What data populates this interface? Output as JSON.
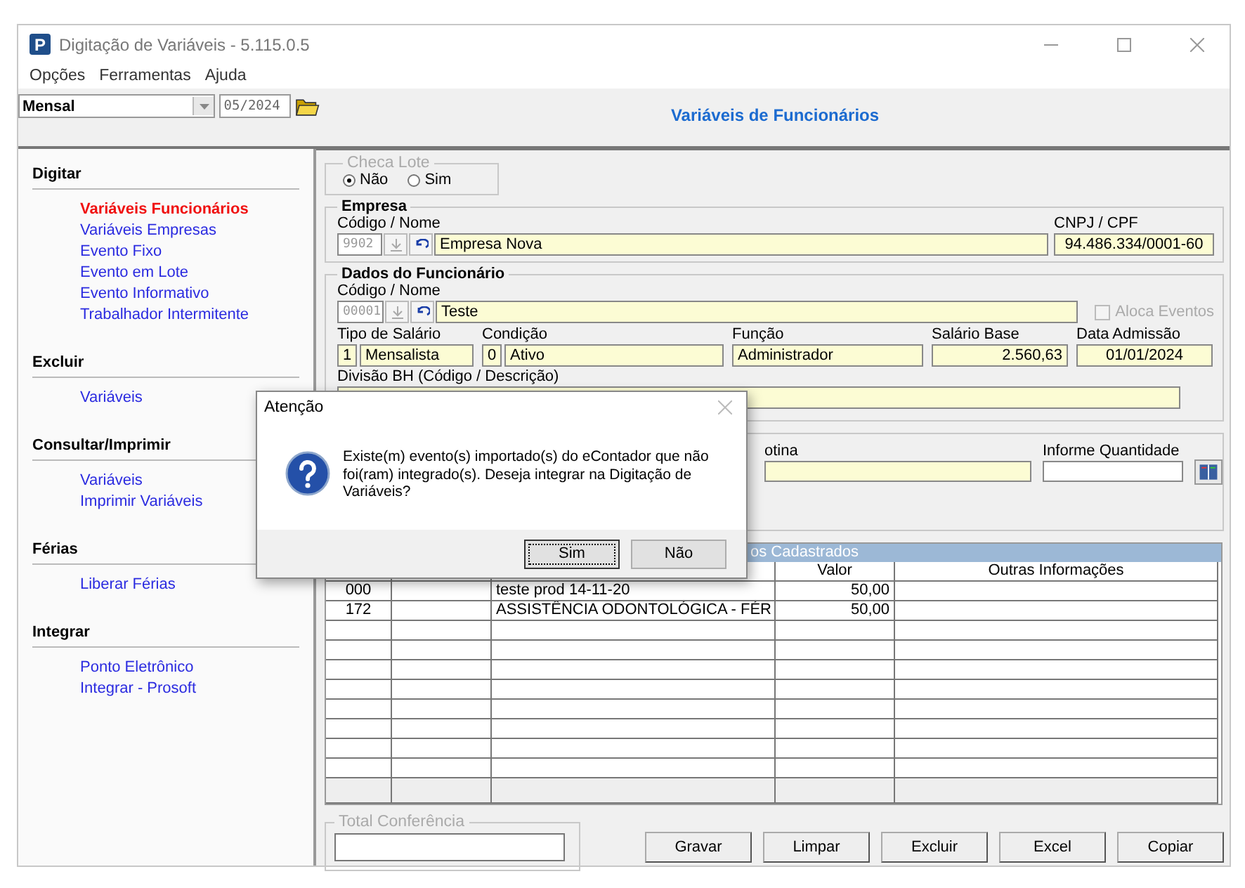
{
  "window": {
    "app_icon": "P",
    "title": "Digitação de Variáveis - 5.115.0.5"
  },
  "menu": [
    "Opções",
    "Ferramentas",
    "Ajuda"
  ],
  "toolbar": {
    "period_type": "Mensal",
    "competence": "05/2024",
    "heading": "Variáveis de Funcionários"
  },
  "sidebar": {
    "sections": [
      {
        "title": "Digitar",
        "items": [
          {
            "label": "Variáveis Funcionários",
            "selected": true
          },
          {
            "label": "Variáveis Empresas",
            "selected": false
          },
          {
            "label": "Evento Fixo",
            "selected": false
          },
          {
            "label": "Evento em Lote",
            "selected": false
          },
          {
            "label": "Evento Informativo",
            "selected": false
          },
          {
            "label": "Trabalhador Intermitente",
            "selected": false
          }
        ]
      },
      {
        "title": "Excluir",
        "items": [
          {
            "label": "Variáveis",
            "selected": false
          }
        ]
      },
      {
        "title": "Consultar/Imprimir",
        "items": [
          {
            "label": "Variáveis",
            "selected": false
          },
          {
            "label": "Imprimir Variáveis",
            "selected": false
          }
        ]
      },
      {
        "title": "Férias",
        "items": [
          {
            "label": "Liberar Férias",
            "selected": false
          }
        ]
      },
      {
        "title": "Integrar",
        "items": [
          {
            "label": "Ponto Eletrônico",
            "selected": false
          },
          {
            "label": "Integrar - Prosoft",
            "selected": false
          }
        ]
      }
    ]
  },
  "checa_lote": {
    "title": "Checa Lote",
    "options": [
      {
        "label": "Não",
        "selected": true
      },
      {
        "label": "Sim",
        "selected": false
      }
    ]
  },
  "empresa": {
    "title": "Empresa",
    "code_label": "Código / Nome",
    "code": "9902",
    "name": "Empresa Nova",
    "cnpj_label": "CNPJ / CPF",
    "cnpj": "94.486.334/0001-60"
  },
  "funcionario": {
    "title": "Dados do Funcionário",
    "code_label": "Código / Nome",
    "code": "00001",
    "name": "Teste",
    "aloca_eventos": {
      "label": "Aloca Eventos",
      "checked": false,
      "disabled": true
    },
    "fields": [
      {
        "kind": "coded",
        "label": "Tipo de Salário",
        "code": "1",
        "value": "Mensalista"
      },
      {
        "kind": "coded",
        "label": "Condição",
        "code": "0",
        "value": "Ativo"
      },
      {
        "kind": "text",
        "label": "Função",
        "value": "Administrador"
      },
      {
        "kind": "amount",
        "label": "Salário Base",
        "value": "2.560,63"
      },
      {
        "kind": "date",
        "label": "Data Admissão",
        "value": "01/01/2024"
      }
    ],
    "divisao_label": "Divisão BH (Código / Descrição)"
  },
  "evento": {
    "rotina_label": "otina",
    "quantidade_label": "Informe Quantidade"
  },
  "grid": {
    "title": "os Cadastrados",
    "columns": [
      "Valor",
      "Outras Informações"
    ],
    "rows": [
      {
        "code": "000",
        "description": "teste prod 14-11-20",
        "value": "50,00"
      },
      {
        "code": "172",
        "description": "ASSISTÊNCIA ODONTOLÓGICA - FÉR",
        "value": "50,00"
      }
    ]
  },
  "total": {
    "title": "Total Conferência"
  },
  "buttons": [
    "Gravar",
    "Limpar",
    "Excluir",
    "Excel",
    "Copiar"
  ],
  "dialog": {
    "title": "Atenção",
    "message": "Existe(m) evento(s) importado(s) do eContador que não foi(ram) integrado(s). Deseja integrar na Digitação de Variáveis?",
    "buttons": [
      {
        "label": "Sim",
        "selected": true
      },
      {
        "label": "Não",
        "selected": false
      }
    ]
  }
}
